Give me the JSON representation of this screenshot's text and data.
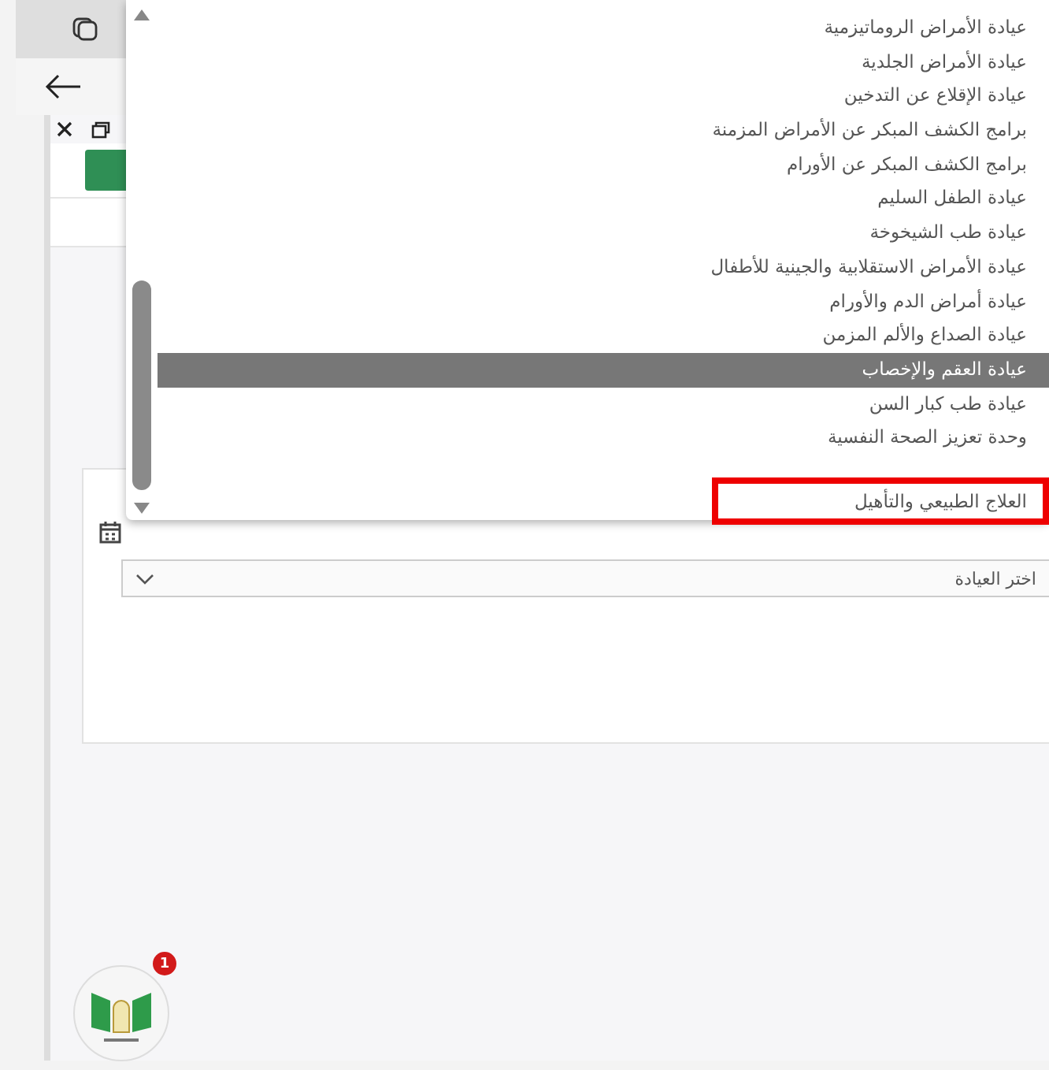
{
  "clinic_select": {
    "placeholder": "اختر العيادة"
  },
  "dropdown": {
    "items": [
      {
        "label": "عيادة الأمراض الروماتيزمية",
        "selected": false,
        "outlined": false
      },
      {
        "label": "عيادة الأمراض الجلدية",
        "selected": false,
        "outlined": false
      },
      {
        "label": "عيادة الإقلاع عن التدخين",
        "selected": false,
        "outlined": false
      },
      {
        "label": "برامج الكشف المبكر عن الأمراض المزمنة",
        "selected": false,
        "outlined": false
      },
      {
        "label": "برامج الكشف المبكر عن الأورام",
        "selected": false,
        "outlined": false
      },
      {
        "label": "عيادة الطفل السليم",
        "selected": false,
        "outlined": false
      },
      {
        "label": "عيادة طب الشيخوخة",
        "selected": false,
        "outlined": false
      },
      {
        "label": "عيادة الأمراض الاستقلابية والجينية للأطفال",
        "selected": false,
        "outlined": false
      },
      {
        "label": "عيادة أمراض الدم والأورام",
        "selected": false,
        "outlined": false
      },
      {
        "label": "عيادة الصداع والألم المزمن",
        "selected": false,
        "outlined": false
      },
      {
        "label": "عيادة العقم والإخصاب",
        "selected": true,
        "outlined": false
      },
      {
        "label": "عيادة طب كبار السن",
        "selected": false,
        "outlined": false
      },
      {
        "label": "وحدة تعزيز الصحة النفسية",
        "selected": false,
        "outlined": false
      },
      {
        "label": "العلاج الطبيعي والتأهيل",
        "selected": false,
        "outlined": true
      }
    ]
  },
  "notification_badge": "1"
}
